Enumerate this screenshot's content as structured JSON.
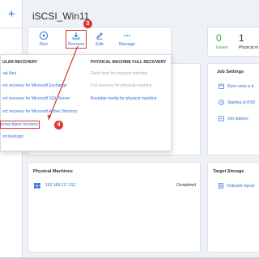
{
  "window": {
    "title": "iSCSI_Win11"
  },
  "sidebar": {
    "add_label": "+"
  },
  "toolbar": {
    "items": [
      {
        "label": "Run",
        "icon": "play-icon"
      },
      {
        "label": "Recover",
        "icon": "download-icon"
      },
      {
        "label": "Edit",
        "icon": "edit-icon"
      },
      {
        "label": "Manage",
        "icon": "more-icon"
      }
    ]
  },
  "stats": {
    "issues_count": "0",
    "issues_label": "Issues",
    "machines_count": "1",
    "machines_label": "Physical m"
  },
  "job_settings": {
    "title": "Job Settings",
    "rows": [
      {
        "text": "Runs once a d",
        "icon": "calendar-icon"
      },
      {
        "text": "Starting at 8:00",
        "icon": "clock-icon"
      },
      {
        "text": "Job options",
        "icon": "options-icon"
      }
    ]
  },
  "recover_menu": {
    "granular_header": "ULAR RECOVERY",
    "full_header": "PHYSICAL MACHINE FULL RECOVERY",
    "granular_items": [
      {
        "label": "ual files"
      },
      {
        "label": "ect recovery for Microsoft Exchange"
      },
      {
        "label": "ect recovery for Microsoft SQL Server"
      },
      {
        "label": "ect recovery for Microsoft Active Directory"
      },
      {
        "label": "ersal object recovery"
      },
      {
        "label": "ort backups"
      }
    ],
    "full_items": [
      {
        "label": "Flash boot for physical machine",
        "enabled": false
      },
      {
        "label": "Full recovery for physical machine",
        "enabled": false
      },
      {
        "label": "Bootable media for physical machine",
        "enabled": true
      }
    ]
  },
  "physical_machines": {
    "title": "Physical Machines",
    "rows": [
      {
        "ip": "192.168.217.112",
        "status": "Completed"
      }
    ]
  },
  "target_storage": {
    "title": "Target Storage",
    "row_text": "Onboard reposi"
  },
  "annotations": {
    "step3": "3",
    "step4": "4"
  },
  "colors": {
    "accent": "#2f6fd6",
    "highlight": "#d93a34",
    "issues_green": "#29a84a",
    "disabled": "#a6acb5"
  }
}
